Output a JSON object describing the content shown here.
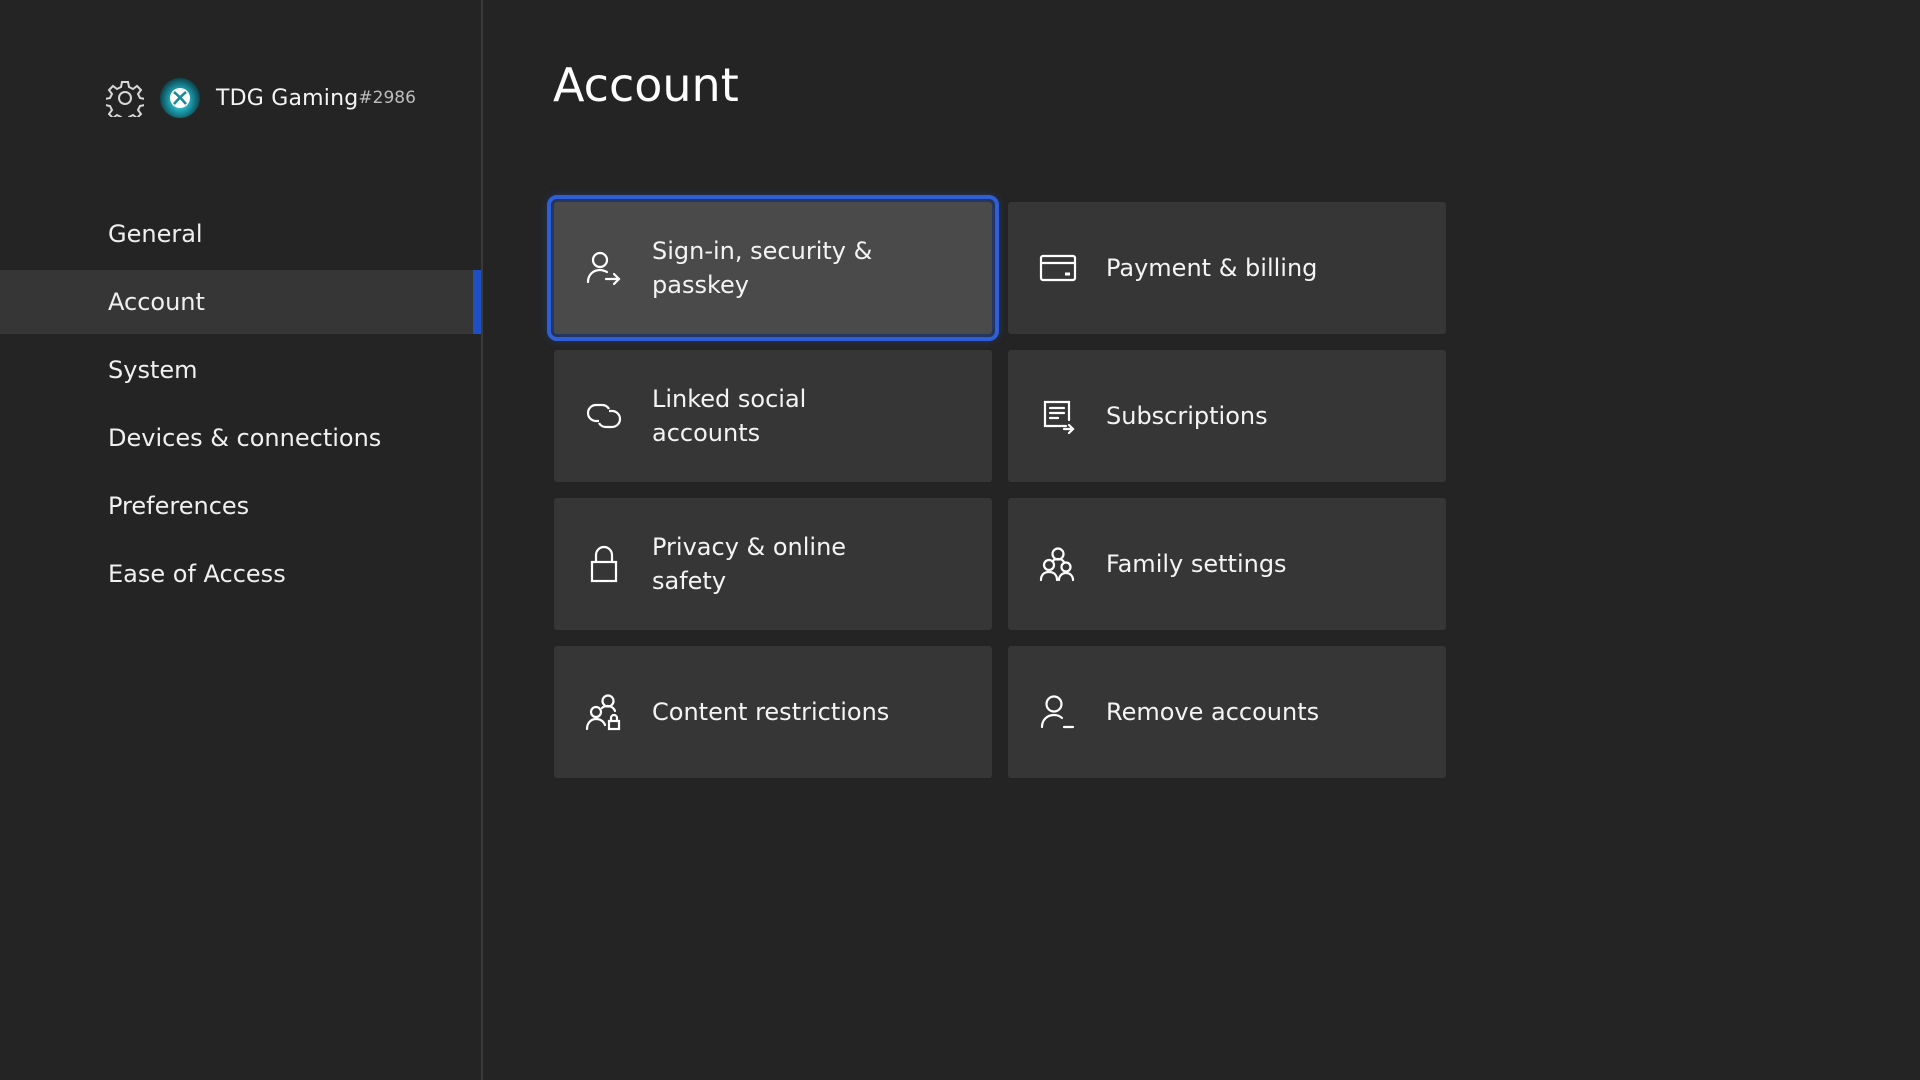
{
  "profile": {
    "gear_icon": "gear-icon",
    "gamertag": "TDG Gaming",
    "gamertag_suffix": "#2986"
  },
  "sidebar": {
    "items": [
      {
        "label": "General",
        "selected": false
      },
      {
        "label": "Account",
        "selected": true
      },
      {
        "label": "System",
        "selected": false
      },
      {
        "label": "Devices & connections",
        "selected": false
      },
      {
        "label": "Preferences",
        "selected": false
      },
      {
        "label": "Ease of Access",
        "selected": false
      }
    ],
    "accent_color": "#1f4fc4"
  },
  "main": {
    "title": "Account",
    "tiles": [
      {
        "label": "Sign-in, security & passkey",
        "icon": "person-arrow-icon",
        "focused": true
      },
      {
        "label": "Payment & billing",
        "icon": "credit-card-icon",
        "focused": false
      },
      {
        "label": "Linked social accounts",
        "icon": "link-icon",
        "focused": false
      },
      {
        "label": "Subscriptions",
        "icon": "subscription-icon",
        "focused": false
      },
      {
        "label": "Privacy & online safety",
        "icon": "lock-icon",
        "focused": false
      },
      {
        "label": "Family settings",
        "icon": "family-icon",
        "focused": false
      },
      {
        "label": "Content restrictions",
        "icon": "people-lock-icon",
        "focused": false
      },
      {
        "label": "Remove accounts",
        "icon": "person-remove-icon",
        "focused": false
      }
    ],
    "focus_color": "#2e5fd6"
  }
}
